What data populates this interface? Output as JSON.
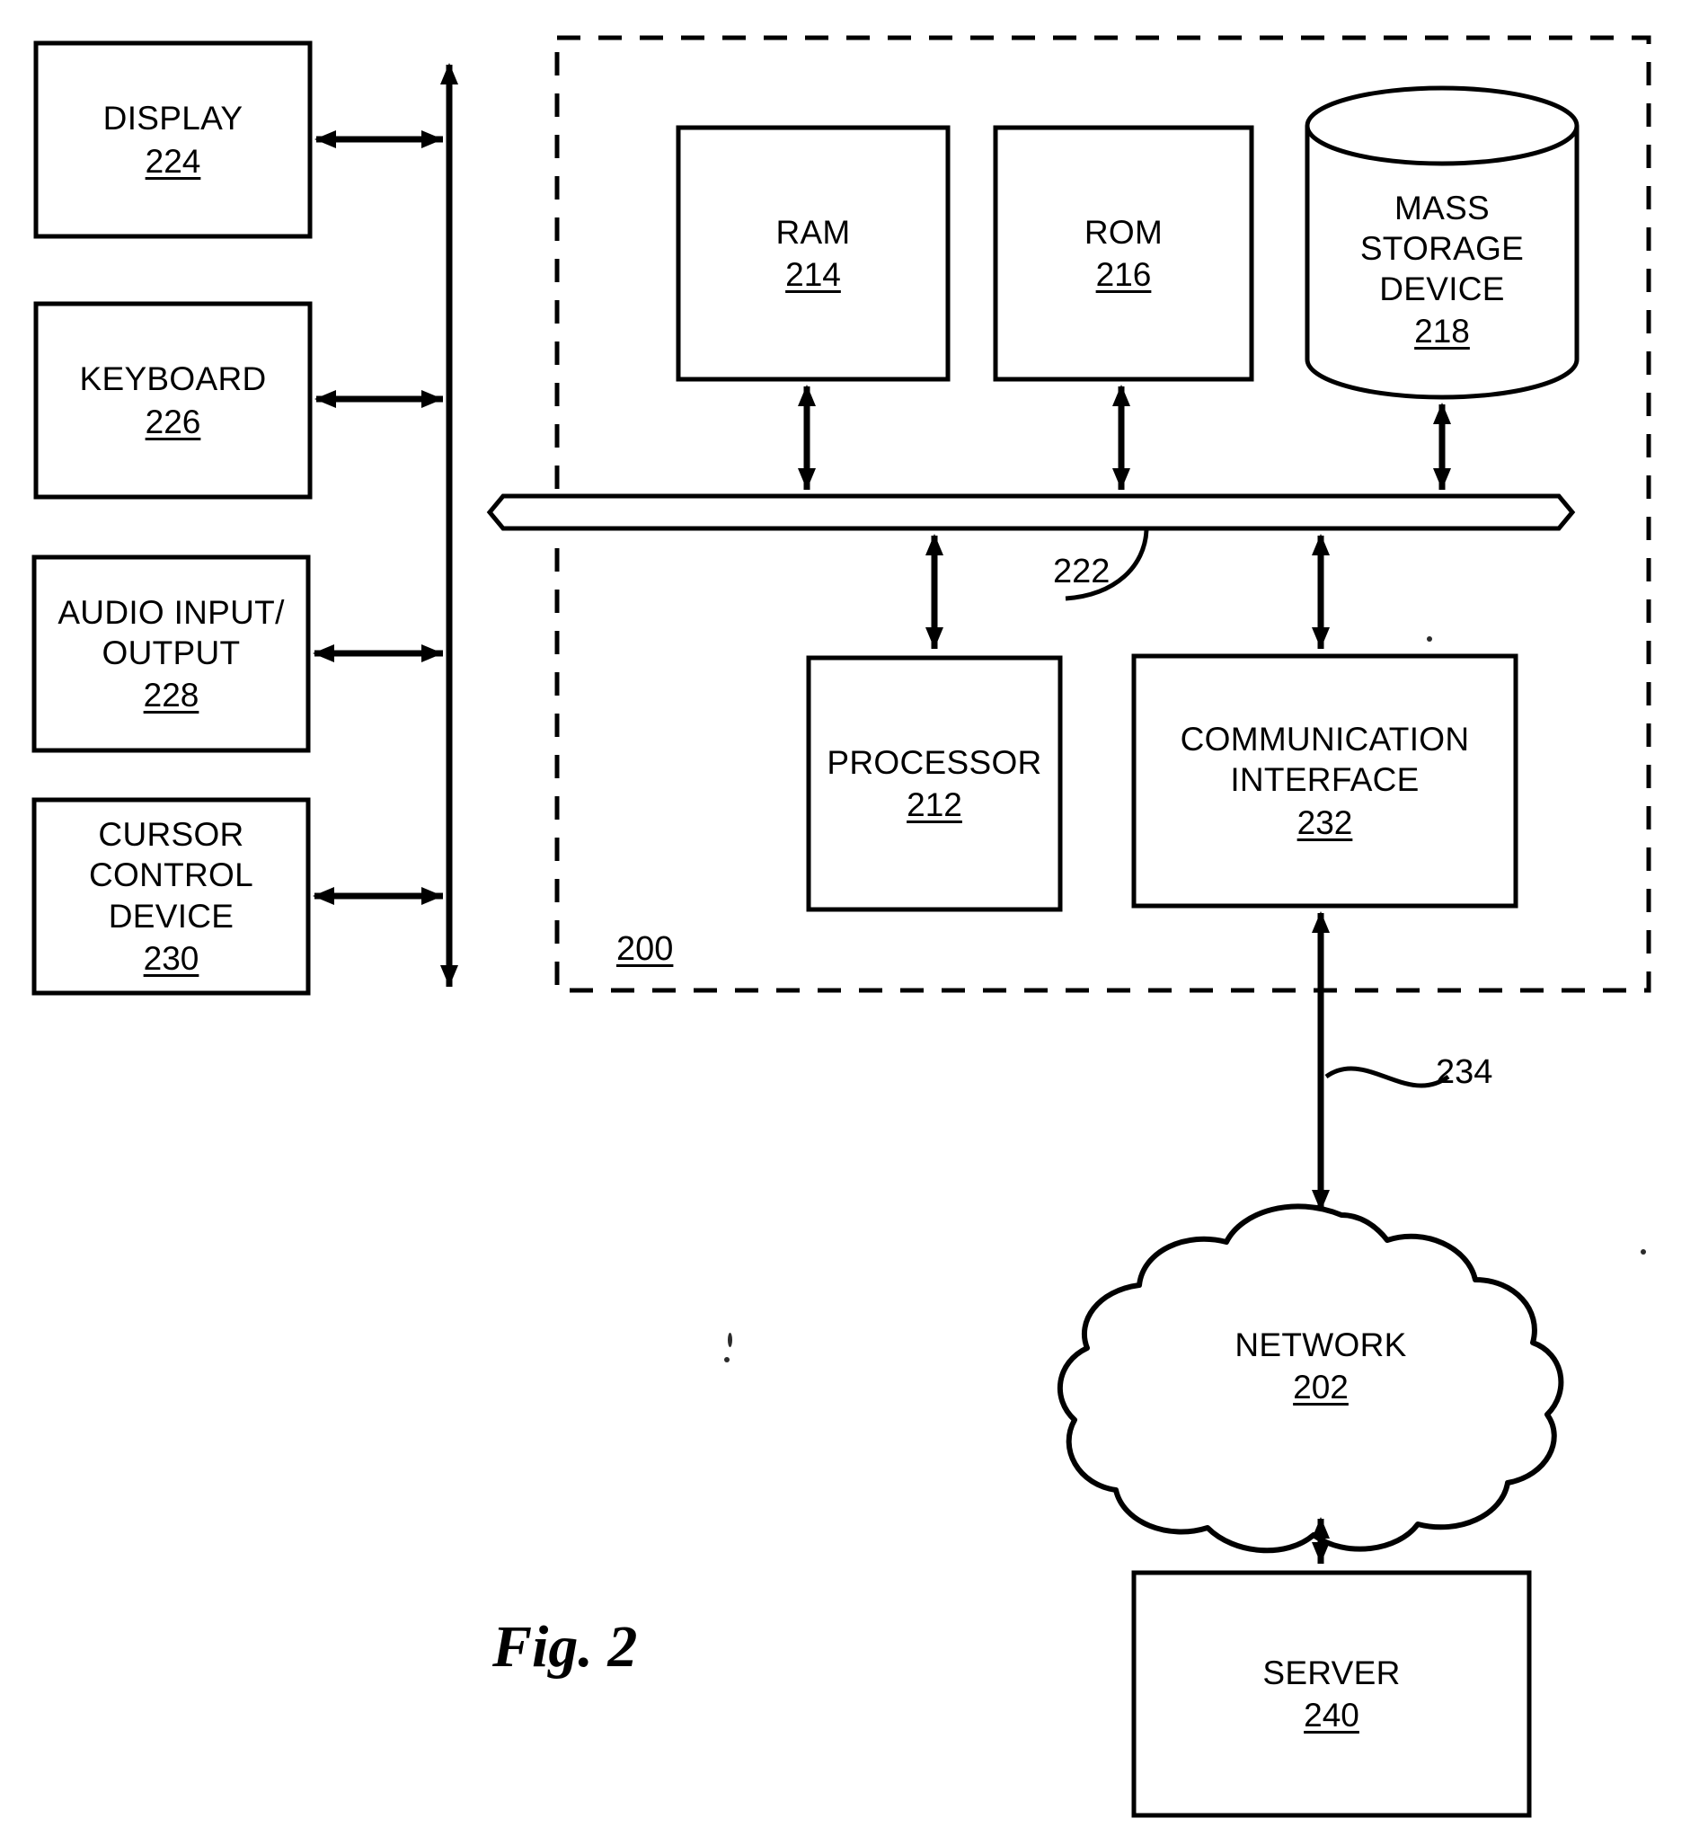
{
  "figure": {
    "caption": "Fig. 2",
    "system_ref": "200",
    "bus_ref": "222",
    "network_link_ref": "234"
  },
  "peripherals": [
    {
      "name": "DISPLAY",
      "lines": [
        "DISPLAY"
      ],
      "ref": "224"
    },
    {
      "name": "KEYBOARD",
      "lines": [
        "KEYBOARD"
      ],
      "ref": "226"
    },
    {
      "name": "AUDIO INPUT/OUTPUT",
      "lines": [
        "AUDIO INPUT/",
        "OUTPUT"
      ],
      "ref": "228"
    },
    {
      "name": "CURSOR CONTROL DEVICE",
      "lines": [
        "CURSOR",
        "CONTROL",
        "DEVICE"
      ],
      "ref": "230"
    }
  ],
  "memory_nodes": [
    {
      "name": "RAM",
      "lines": [
        "RAM"
      ],
      "ref": "214"
    },
    {
      "name": "ROM",
      "lines": [
        "ROM"
      ],
      "ref": "216"
    },
    {
      "name": "MASS STORAGE DEVICE",
      "lines": [
        "MASS",
        "STORAGE",
        "DEVICE"
      ],
      "ref": "218"
    }
  ],
  "compute_nodes": [
    {
      "name": "PROCESSOR",
      "lines": [
        "PROCESSOR"
      ],
      "ref": "212"
    },
    {
      "name": "COMMUNICATION INTERFACE",
      "lines": [
        "COMMUNICATION",
        "INTERFACE"
      ],
      "ref": "232"
    }
  ],
  "external_nodes": [
    {
      "name": "NETWORK",
      "lines": [
        "NETWORK"
      ],
      "ref": "202"
    },
    {
      "name": "SERVER",
      "lines": [
        "SERVER"
      ],
      "ref": "240"
    }
  ],
  "colors": {
    "ink": "#000000",
    "paper": "#ffffff"
  }
}
